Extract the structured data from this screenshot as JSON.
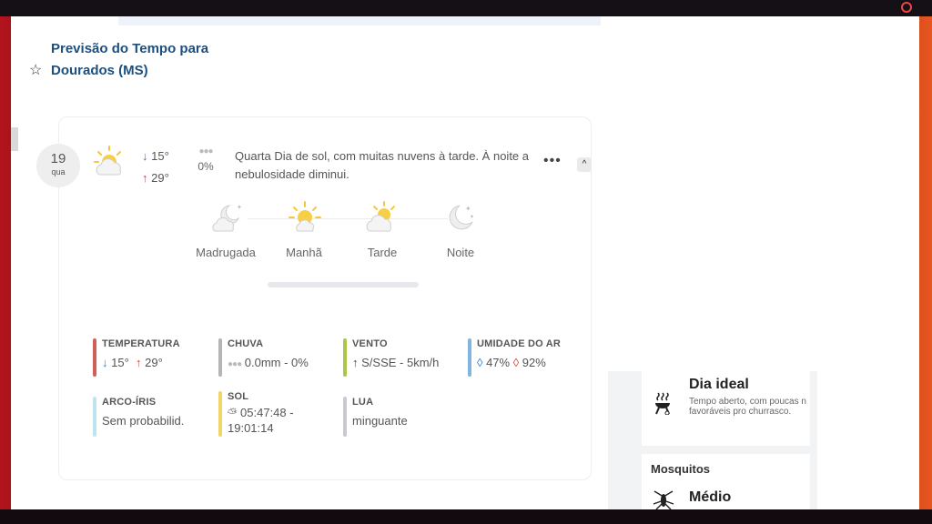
{
  "header": {
    "title": "Previsão do Tempo para Dourados (MS)"
  },
  "forecast": {
    "day_number": "19",
    "day_abbr": "qua",
    "temp_min": "15°",
    "temp_max": "29°",
    "rain_chance": "0%",
    "description": "Quarta Dia de sol, com muitas nuvens à tarde. À noite a nebulosidade diminui.",
    "more_label": "•••",
    "collapse_label": "^"
  },
  "periods": [
    {
      "label": "Madrugada",
      "icon": "moon-cloud-icon"
    },
    {
      "label": "Manhã",
      "icon": "sun-icon"
    },
    {
      "label": "Tarde",
      "icon": "sun-cloud-icon"
    },
    {
      "label": "Noite",
      "icon": "moon-icon"
    }
  ],
  "stats": {
    "temperature": {
      "label": "TEMPERATURA",
      "min": "15°",
      "max": "29°",
      "color": "#d0605a"
    },
    "rain": {
      "label": "CHUVA",
      "value": "0.0mm - 0%",
      "color": "#b5b5b5"
    },
    "wind": {
      "label": "VENTO",
      "value": "S/SSE - 5km/h",
      "color": "#a9c84a"
    },
    "humidity": {
      "label": "UMIDADE DO AR",
      "min": "47%",
      "max": "92%",
      "color": "#7fb5e0"
    },
    "rainbow": {
      "label": "ARCO-ÍRIS",
      "value": "Sem probabilid.",
      "color": "#bfe4ef"
    },
    "sun": {
      "label": "SOL",
      "value": "05:47:48 - 19:01:14",
      "color": "#f0d56a"
    },
    "moon": {
      "label": "LUA",
      "value": "minguante",
      "color": "#c8cad0"
    }
  },
  "side": {
    "ideal_title": "Dia ideal",
    "ideal_desc_line1": "Tempo aberto, com poucas n",
    "ideal_desc_line2": "favoráveis pro churrasco.",
    "mosquito_title": "Mosquitos",
    "mosquito_level": "Médio"
  },
  "colors": {
    "title_blue": "#1b4f80",
    "arrow_down": "#2b7bd6",
    "arrow_up": "#d9413a"
  }
}
